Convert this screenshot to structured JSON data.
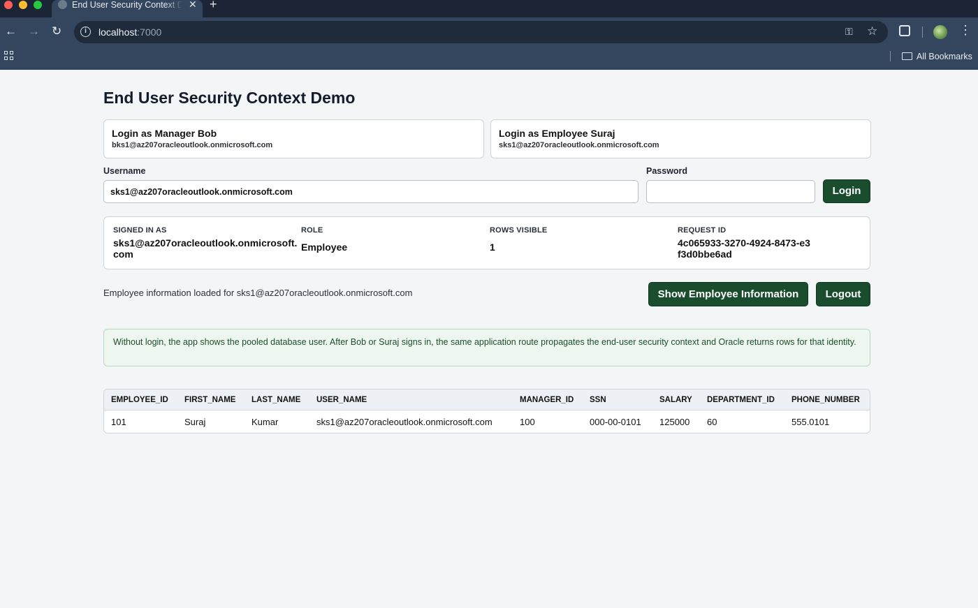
{
  "browser": {
    "tab_title": "End User Security Context Demo",
    "url_host": "localhost",
    "url_port": ":7000",
    "bookmarks_label": "All Bookmarks"
  },
  "page": {
    "title": "End User Security Context Demo"
  },
  "quick_logins": {
    "bob": {
      "title": "Login as Manager Bob",
      "email": "bks1@az207oracleoutlook.onmicrosoft.com"
    },
    "suraj": {
      "title": "Login as Employee Suraj",
      "email": "sks1@az207oracleoutlook.onmicrosoft.com"
    }
  },
  "login_form": {
    "username_label": "Username",
    "username_value": "sks1@az207oracleoutlook.onmicrosoft.com",
    "password_label": "Password",
    "password_value": "",
    "login_button": "Login"
  },
  "session": {
    "signed_in_label": "SIGNED IN AS",
    "signed_in_value": "sks1@az207oracleoutlook.onmicrosoft.com",
    "role_label": "ROLE",
    "role_value": "Employee",
    "rows_label": "ROWS VISIBLE",
    "rows_value": "1",
    "request_label": "REQUEST ID",
    "request_value": "4c065933-3270-4924-8473-e3f3d0bbe6ad"
  },
  "actions": {
    "status_message": "Employee information loaded for sks1@az207oracleoutlook.onmicrosoft.com",
    "show_button": "Show Employee Information",
    "logout_button": "Logout"
  },
  "note": "Without login, the app shows the pooled database user. After Bob or Suraj signs in, the same application route propagates the end-user security context and Oracle returns rows for that identity.",
  "table": {
    "columns": [
      "EMPLOYEE_ID",
      "FIRST_NAME",
      "LAST_NAME",
      "USER_NAME",
      "MANAGER_ID",
      "SSN",
      "SALARY",
      "DEPARTMENT_ID",
      "PHONE_NUMBER"
    ],
    "rows": [
      [
        "101",
        "Suraj",
        "Kumar",
        "sks1@az207oracleoutlook.onmicrosoft.com",
        "100",
        "000-00-0101",
        "125000",
        "60",
        "555.0101"
      ]
    ]
  },
  "colors": {
    "accent_green": "#1a4d2e",
    "note_background": "#edf6ef",
    "chrome_dark": "#1b2535",
    "chrome_toolbar": "#34465e"
  }
}
